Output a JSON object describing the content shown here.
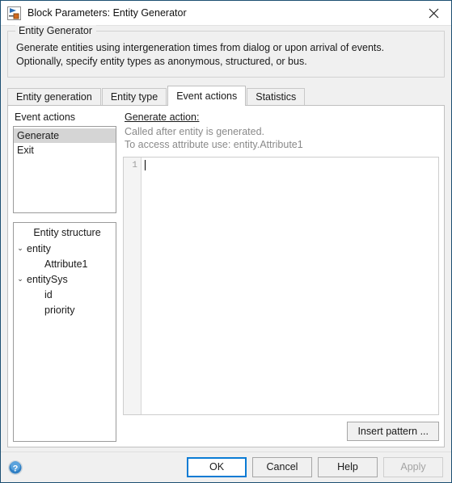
{
  "window": {
    "title": "Block Parameters: Entity Generator",
    "icon": "simulink-block-icon",
    "close_label": "✕"
  },
  "group": {
    "legend": "Entity Generator",
    "description_lines": [
      "Generate entities using intergeneration times from dialog or upon arrival of events.",
      "Optionally, specify entity types as anonymous, structured, or bus."
    ]
  },
  "tabs": [
    {
      "label": "Entity generation",
      "active": false
    },
    {
      "label": "Entity type",
      "active": false
    },
    {
      "label": "Event actions",
      "active": true
    },
    {
      "label": "Statistics",
      "active": false
    }
  ],
  "event_actions": {
    "label": "Event actions",
    "items": [
      {
        "label": "Generate",
        "selected": true
      },
      {
        "label": "Exit",
        "selected": false
      }
    ]
  },
  "entity_structure": {
    "title": "Entity structure",
    "nodes": [
      {
        "label": "entity",
        "chevron": "⌄",
        "level": 0
      },
      {
        "label": "Attribute1",
        "chevron": "",
        "level": 1
      },
      {
        "label": "entitySys",
        "chevron": "⌄",
        "level": 0
      },
      {
        "label": "id",
        "chevron": "",
        "level": 1
      },
      {
        "label": "priority",
        "chevron": "",
        "level": 1
      }
    ]
  },
  "action_panel": {
    "title": "Generate action:",
    "hint_lines": [
      "Called after entity is generated.",
      "To access attribute use: entity.Attribute1"
    ],
    "editor": {
      "line_numbers": "1",
      "code": ""
    },
    "insert_pattern_label": "Insert pattern ..."
  },
  "footer": {
    "help_icon": "help-question-icon",
    "ok_label": "OK",
    "cancel_label": "Cancel",
    "help_label": "Help",
    "apply_label": "Apply"
  },
  "colors": {
    "accent": "#0a7bd4",
    "window_border": "#1c4f72",
    "dialog_bg": "#f0f0f0",
    "selection": "#d5d5d5",
    "hint_text": "#8a8a8a"
  }
}
